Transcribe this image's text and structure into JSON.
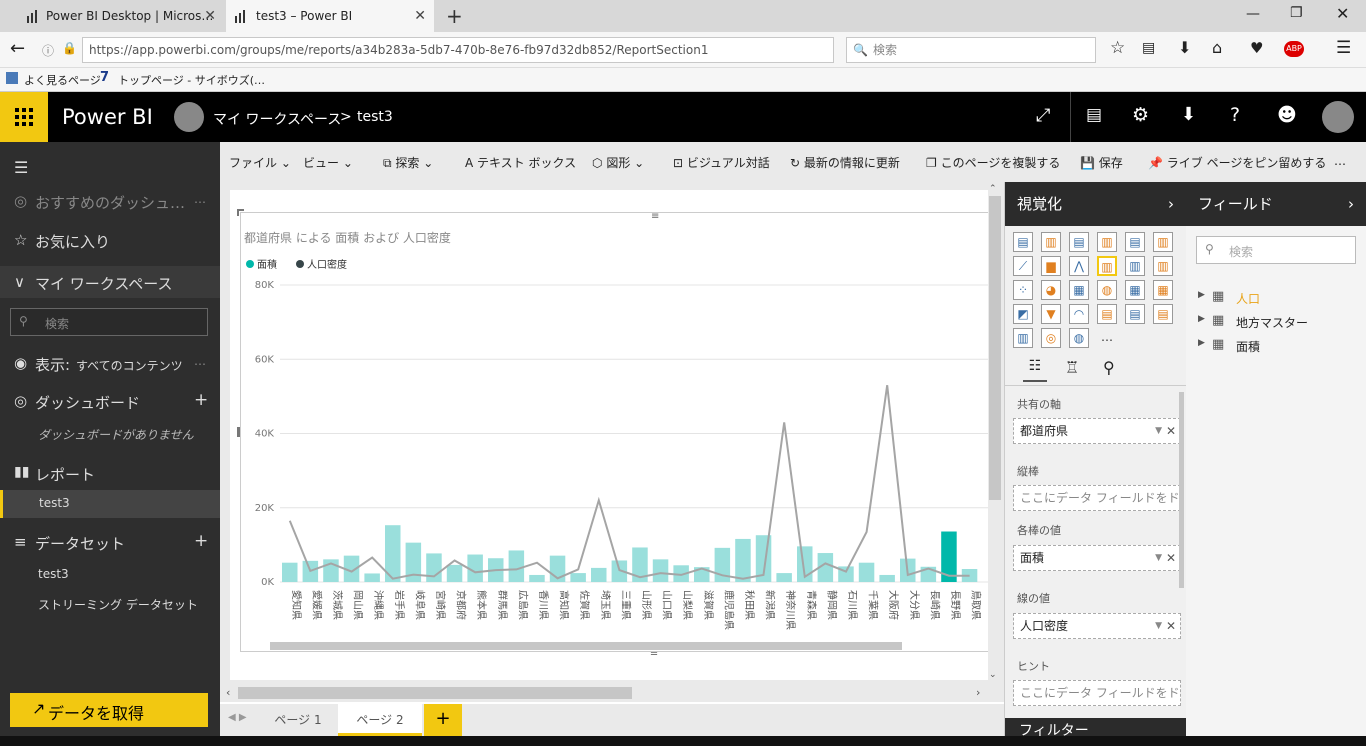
{
  "browser": {
    "tabs": [
      {
        "title": "Power BI Desktop | Micros…"
      },
      {
        "title": "test3 – Power BI"
      }
    ],
    "url": "https://app.powerbi.com/groups/me/reports/a34b283a-5db7-470b-8e76-fb97d32db852/ReportSection1",
    "search_placeholder": "検索",
    "bookmarks": [
      "よく見るページ",
      "トップページ - サイボウズ(…"
    ]
  },
  "header": {
    "app_name": "Power BI",
    "breadcrumb_workspace": "マイ ワークスペース",
    "breadcrumb_sep": ">",
    "breadcrumb_report": "test3"
  },
  "sidebar": {
    "recommended": "おすすめのダッシュ…",
    "favorites": "お気に入り",
    "workspace": "マイ ワークスペース",
    "search_placeholder": "検索",
    "view_label": "表示:",
    "view_value": "すべてのコンテンツ",
    "dashboards": "ダッシュボード",
    "no_dashboards": "ダッシュボードがありません",
    "reports": "レポート",
    "report_item": "test3",
    "datasets": "データセット",
    "dataset_item1": "test3",
    "dataset_item2": "ストリーミング データセット",
    "get_data": "データを取得"
  },
  "toolbar": {
    "file": "ファイル",
    "view": "ビュー",
    "explore": "探索",
    "textbox": "テキスト ボックス",
    "shapes": "図形",
    "visual_interactions": "ビジュアル対話",
    "refresh": "最新の情報に更新",
    "duplicate": "このページを複製する",
    "save": "保存",
    "pin": "ライブ ページをピン留めする",
    "more": "…"
  },
  "visualizations": {
    "title": "視覚化",
    "shared_axis_label": "共有の軸",
    "shared_axis_value": "都道府県",
    "column_series_label": "縦棒",
    "column_series_placeholder": "ここにデータ フィールドをドラ…",
    "column_values_label": "各棒の値",
    "column_values_value": "面積",
    "line_values_label": "線の値",
    "line_values_value": "人口密度",
    "tooltips_label": "ヒント",
    "tooltips_placeholder": "ここにデータ フィールドをドラ…",
    "filters_label": "フィルター",
    "more_icon": "…"
  },
  "fields": {
    "title": "フィールド",
    "search_placeholder": "検索",
    "tables": [
      {
        "name": "人口"
      },
      {
        "name": "地方マスター"
      },
      {
        "name": "面積"
      }
    ]
  },
  "page_tabs": [
    {
      "label": "ページ 1"
    },
    {
      "label": "ページ 2"
    }
  ],
  "colors": {
    "accent": "#f2c811",
    "bar": "#9adfdc",
    "bar_selected": "#01b8aa",
    "line": "#a5a5a5"
  },
  "chart_data": {
    "type": "bar",
    "title": "都道府県 による 面積 および 人口密度",
    "legend": [
      "面積",
      "人口密度"
    ],
    "legend_position": "top-left",
    "y_ticks": [
      "0K",
      "20K",
      "40K",
      "60K",
      "80K"
    ],
    "ylim": [
      0,
      80000
    ],
    "categories": [
      "愛知県",
      "愛媛県",
      "茨城県",
      "岡山県",
      "沖縄県",
      "岩手県",
      "岐阜県",
      "宮崎県",
      "京都府",
      "熊本県",
      "群馬県",
      "広島県",
      "香川県",
      "高知県",
      "佐賀県",
      "埼玉県",
      "三重県",
      "山形県",
      "山口県",
      "山梨県",
      "滋賀県",
      "鹿児島県",
      "秋田県",
      "新潟県",
      "神奈川県",
      "青森県",
      "静岡県",
      "石川県",
      "千葉県",
      "大阪府",
      "大分県",
      "長崎県",
      "長野県",
      "鳥取県"
    ],
    "series": [
      {
        "name": "面積",
        "values": [
          5200,
          5700,
          6100,
          7100,
          2300,
          15300,
          10600,
          7700,
          4600,
          7400,
          6400,
          8500,
          1900,
          7100,
          2400,
          3800,
          5800,
          9300,
          6100,
          4500,
          4000,
          9200,
          11600,
          12600,
          2400,
          9600,
          7800,
          4200,
          5200,
          1900,
          6300,
          4100,
          13600,
          3500
        ]
      },
      {
        "name": "人口密度",
        "values": [
          16500,
          3000,
          5000,
          2800,
          6600,
          900,
          2000,
          1500,
          5800,
          2600,
          3200,
          3400,
          5200,
          1000,
          3400,
          22000,
          3200,
          1300,
          2400,
          1900,
          3600,
          1800,
          900,
          1900,
          43000,
          1400,
          5000,
          2800,
          13500,
          53000,
          1900,
          3600,
          1700,
          1700
        ]
      }
    ],
    "selected_index": 32
  }
}
